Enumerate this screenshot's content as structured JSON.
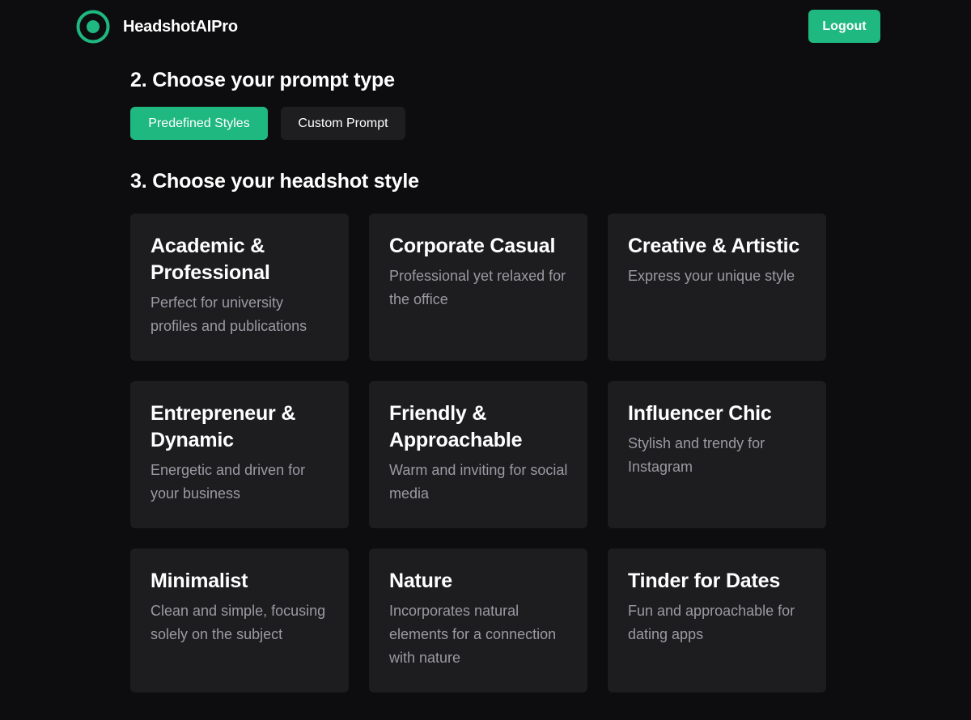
{
  "header": {
    "brand": "HeadshotAIPro",
    "logout_label": "Logout"
  },
  "colors": {
    "accent": "#1fb880",
    "background": "#0d0d0f",
    "card": "#1d1d20",
    "muted_text": "#9a9aa1"
  },
  "icons": {
    "logo": "target-circle-icon"
  },
  "prompt_type": {
    "title": "2. Choose your prompt type",
    "options": [
      {
        "label": "Predefined Styles",
        "selected": true
      },
      {
        "label": "Custom Prompt",
        "selected": false
      }
    ]
  },
  "headshot_style": {
    "title": "3. Choose your headshot style",
    "styles": [
      {
        "title": "Academic & Professional",
        "description": "Perfect for university profiles and publications"
      },
      {
        "title": "Corporate Casual",
        "description": "Professional yet relaxed for the office"
      },
      {
        "title": "Creative & Artistic",
        "description": "Express your unique style"
      },
      {
        "title": "Entrepreneur & Dynamic",
        "description": "Energetic and driven for your business"
      },
      {
        "title": "Friendly & Approachable",
        "description": "Warm and inviting for social media"
      },
      {
        "title": "Influencer Chic",
        "description": "Stylish and trendy for Instagram"
      },
      {
        "title": "Minimalist",
        "description": "Clean and simple, focusing solely on the subject"
      },
      {
        "title": "Nature",
        "description": "Incorporates natural elements for a connection with nature"
      },
      {
        "title": "Tinder for Dates",
        "description": "Fun and approachable for dating apps"
      }
    ]
  }
}
